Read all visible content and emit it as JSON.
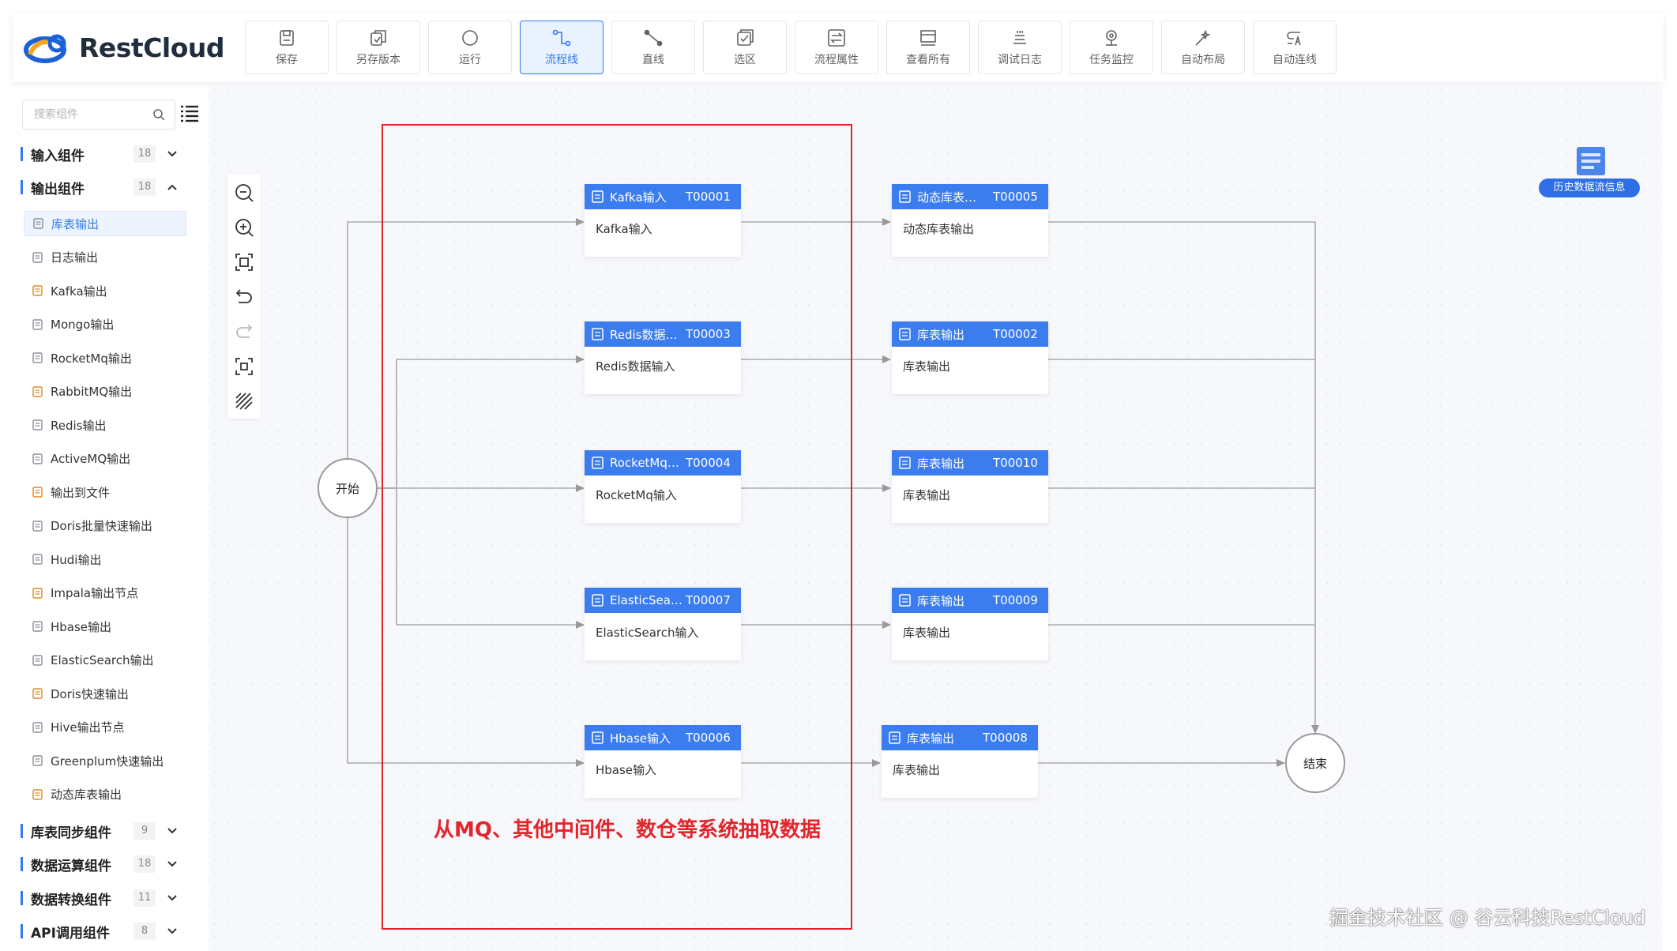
{
  "header": {
    "brand": "RestCloud",
    "toolbar": [
      {
        "label": "保存",
        "icon": "save-icon"
      },
      {
        "label": "另存版本",
        "icon": "copy-icon"
      },
      {
        "label": "运行",
        "icon": "run-icon"
      },
      {
        "label": "流程线",
        "icon": "flowline-icon",
        "active": true
      },
      {
        "label": "直线",
        "icon": "line-icon"
      },
      {
        "label": "选区",
        "icon": "select-area-icon"
      },
      {
        "label": "流程属性",
        "icon": "flow-properties-icon"
      },
      {
        "label": "查看所有",
        "icon": "view-all-icon"
      },
      {
        "label": "调试日志",
        "icon": "debug-log-icon"
      },
      {
        "label": "任务监控",
        "icon": "task-monitor-icon"
      },
      {
        "label": "自动布局",
        "icon": "auto-layout-icon"
      },
      {
        "label": "自动连线",
        "icon": "auto-connect-icon"
      }
    ]
  },
  "sidebar": {
    "search_placeholder": "搜索组件",
    "groups": [
      {
        "name": "输入组件",
        "count": "18",
        "expanded": false
      },
      {
        "name": "输出组件",
        "count": "18",
        "expanded": true
      },
      {
        "name": "库表同步组件",
        "count": "9",
        "expanded": false
      },
      {
        "name": "数据运算组件",
        "count": "18",
        "expanded": false
      },
      {
        "name": "数据转换组件",
        "count": "11",
        "expanded": false
      },
      {
        "name": "API调用组件",
        "count": "8",
        "expanded": false
      }
    ],
    "output_items": [
      "库表输出",
      "日志输出",
      "Kafka输出",
      "Mongo输出",
      "RocketMq输出",
      "RabbitMQ输出",
      "Redis输出",
      "ActiveMQ输出",
      "输出到文件",
      "Doris批量快速输出",
      "Hudi输出",
      "Impala输出节点",
      "Hbase输出",
      "ElasticSearch输出",
      "Doris快速输出",
      "Hive输出节点",
      "Greenplum快速输出",
      "动态库表输出"
    ],
    "selected_item": "库表输出"
  },
  "canvas": {
    "start_label": "开始",
    "end_label": "结束",
    "input_nodes": [
      {
        "title": "Kafka输入",
        "id": "T00001",
        "body": "Kafka输入"
      },
      {
        "title": "Redis数据…",
        "id": "T00003",
        "body": "Redis数据输入"
      },
      {
        "title": "RocketMq…",
        "id": "T00004",
        "body": "RocketMq输入"
      },
      {
        "title": "ElasticSea…",
        "id": "T00007",
        "body": "ElasticSearch输入"
      },
      {
        "title": "Hbase输入",
        "id": "T00006",
        "body": "Hbase输入"
      }
    ],
    "output_nodes": [
      {
        "title": "动态库表…",
        "id": "T00005",
        "body": "动态库表输出"
      },
      {
        "title": "库表输出",
        "id": "T00002",
        "body": "库表输出"
      },
      {
        "title": "库表输出",
        "id": "T00010",
        "body": "库表输出"
      },
      {
        "title": "库表输出",
        "id": "T00009",
        "body": "库表输出"
      },
      {
        "title": "库表输出",
        "id": "T00008",
        "body": "库表输出"
      }
    ],
    "annotation": "从MQ、其他中间件、数仓等系统抽取数据",
    "history_label": "历史数据流信息",
    "watermark": "掘金技术社区 @ 谷云科技RestCloud"
  },
  "colors": {
    "accent": "#2f7bf0",
    "node_header": "#3b7cee",
    "annotation": "#e2252b"
  }
}
